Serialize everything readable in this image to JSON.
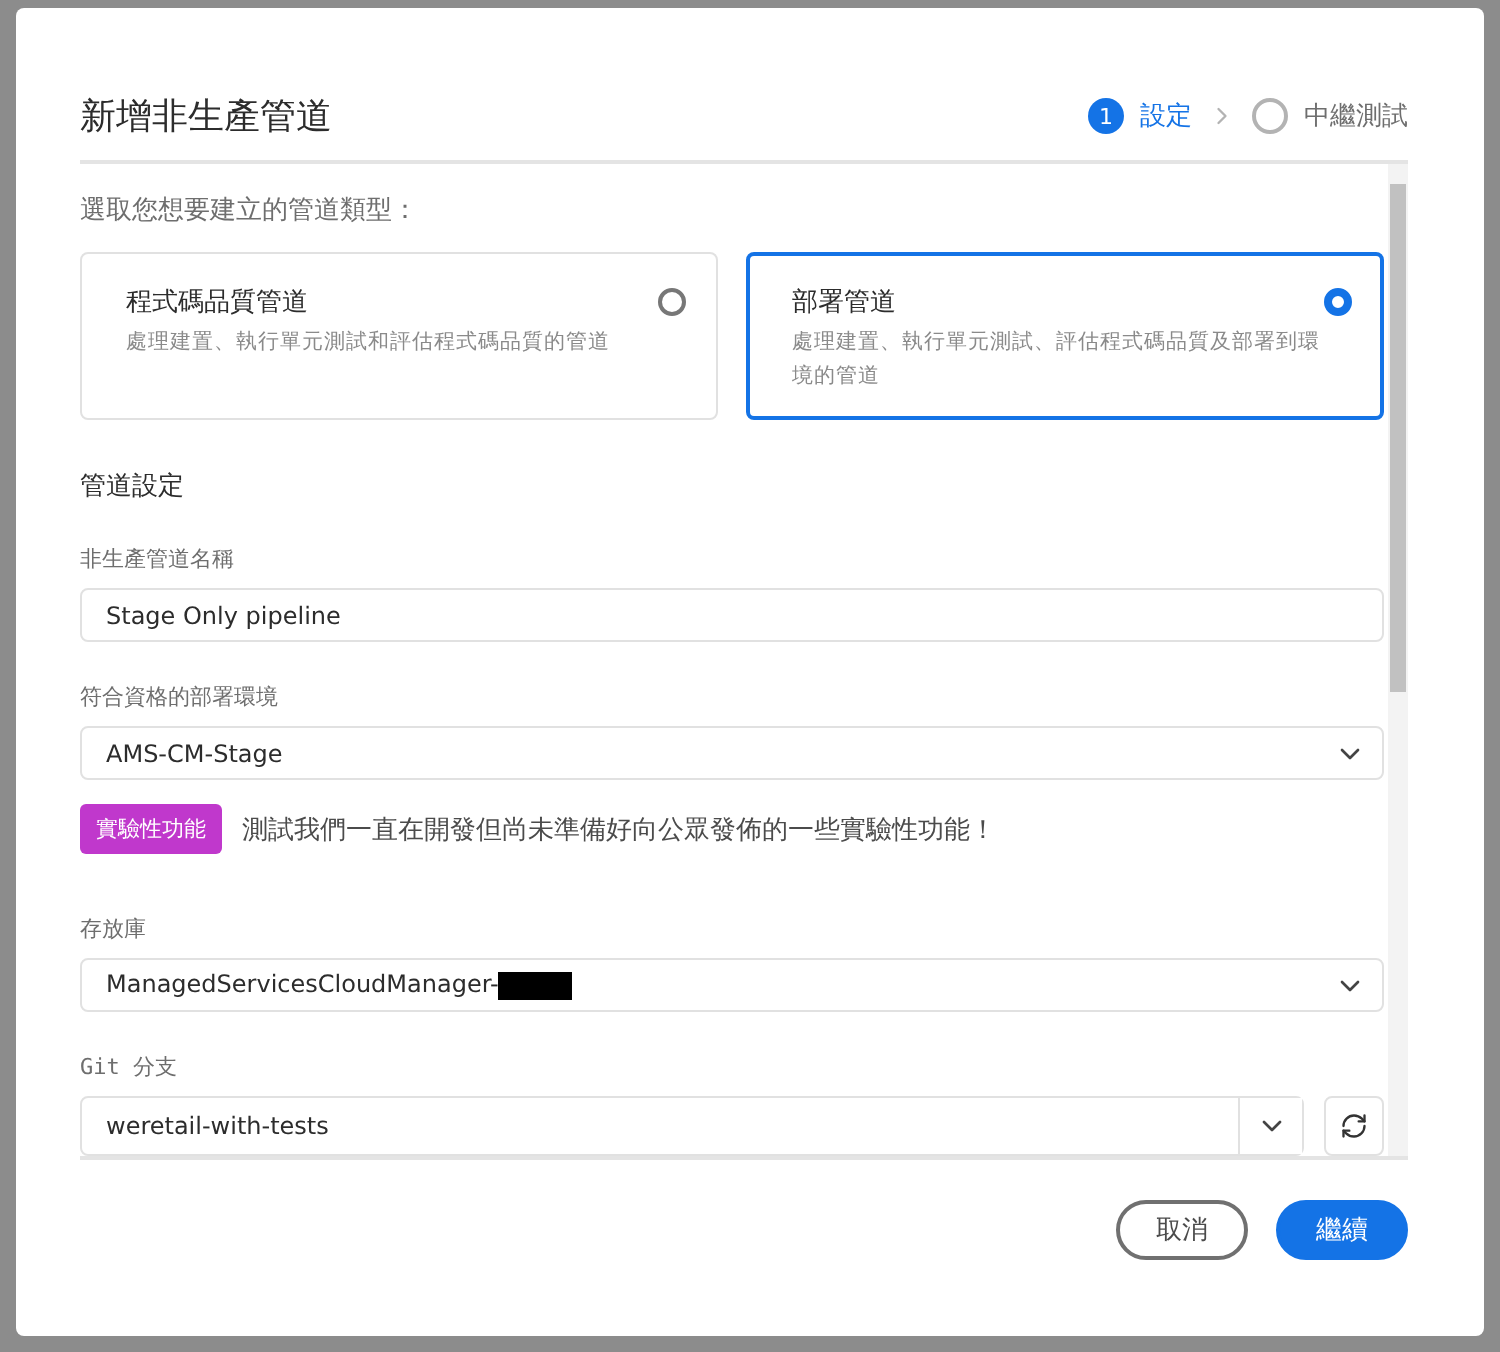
{
  "dialog": {
    "title": "新增非生產管道",
    "steps": [
      {
        "number": "1",
        "label": "設定",
        "selected": true
      },
      {
        "label": "中繼測試",
        "selected": false
      }
    ],
    "type_prompt": "選取您想要建立的管道類型：",
    "pipeline_types": [
      {
        "title": "程式碼品質管道",
        "description": "處理建置、執行單元測試和評估程式碼品質的管道",
        "selected": false
      },
      {
        "title": "部署管道",
        "description": "處理建置、執行單元測試、評估程式碼品質及部署到環境的管道",
        "selected": true
      }
    ],
    "section_title": "管道設定",
    "name_field": {
      "label": "非生產管道名稱",
      "value": "Stage Only pipeline"
    },
    "environment_field": {
      "label": "符合資格的部署環境",
      "value": "AMS-CM-Stage"
    },
    "experimental": {
      "badge": "實驗性功能",
      "text": "測試我們一直在開發但尚未準備好向公眾發佈的一些實驗性功能！"
    },
    "repository_field": {
      "label": "存放庫",
      "value": "ManagedServicesCloudManager-",
      "redacted": true
    },
    "branch_field": {
      "label": "Git 分支",
      "value": "weretail-with-tests"
    },
    "buttons": [
      {
        "label": "取消",
        "kind": "secondary"
      },
      {
        "label": "繼續",
        "kind": "primary"
      }
    ]
  }
}
